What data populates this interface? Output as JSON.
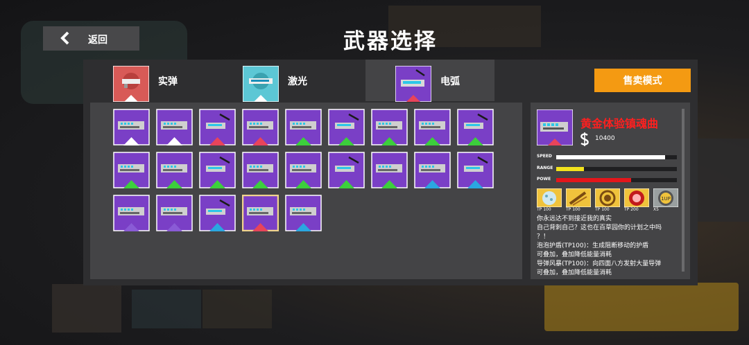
{
  "header": {
    "back_label": "返回",
    "title": "武器选择"
  },
  "tabs": [
    {
      "label": "实弹",
      "color": "#d85a57",
      "active": false
    },
    {
      "label": "激光",
      "color": "#5cc7d5",
      "active": false
    },
    {
      "label": "电弧",
      "color": "#7a3fc6",
      "active": true
    }
  ],
  "sell_mode_label": "售卖模式",
  "colors": {
    "accent": "#f49a12",
    "card_bg": "#7a3fc6",
    "selected_border": "#f0d48c"
  },
  "weapons": [
    {
      "tier": "white",
      "selected": false
    },
    {
      "tier": "white",
      "selected": false
    },
    {
      "tier": "red",
      "selected": false
    },
    {
      "tier": "red",
      "selected": false
    },
    {
      "tier": "green",
      "selected": false
    },
    {
      "tier": "green",
      "selected": false
    },
    {
      "tier": "green",
      "selected": false
    },
    {
      "tier": "green",
      "selected": false
    },
    {
      "tier": "green",
      "selected": false
    },
    {
      "tier": "green",
      "selected": false
    },
    {
      "tier": "green",
      "selected": false
    },
    {
      "tier": "green",
      "selected": false
    },
    {
      "tier": "green",
      "selected": false
    },
    {
      "tier": "green",
      "selected": false
    },
    {
      "tier": "green",
      "selected": false
    },
    {
      "tier": "green",
      "selected": false
    },
    {
      "tier": "blue",
      "selected": false
    },
    {
      "tier": "blue",
      "selected": false
    },
    {
      "tier": "purple",
      "selected": false
    },
    {
      "tier": "purple",
      "selected": false
    },
    {
      "tier": "blue",
      "selected": false
    },
    {
      "tier": "red",
      "selected": true
    },
    {
      "tier": "blue",
      "selected": false
    }
  ],
  "detail": {
    "name": "黄金体验镇魂曲",
    "price": "10400",
    "stats": [
      {
        "label": "SPEED",
        "value": 0.9,
        "color": "#ffffff"
      },
      {
        "label": "RANGE",
        "value": 0.23,
        "color": "#f2e21d"
      },
      {
        "label": "POWE",
        "value": 0.62,
        "color": "#e4161b"
      }
    ],
    "skills": [
      {
        "label": "TP 100",
        "icon": "bubble-shield-icon"
      },
      {
        "label": "TP 100",
        "icon": "missile-storm-icon"
      },
      {
        "label": "TP 100",
        "icon": "gold-wave-icon"
      },
      {
        "label": "TP 200",
        "icon": "red-burst-icon"
      },
      {
        "label": "X5",
        "icon": "one-up-icon"
      }
    ],
    "description": [
      "你永远达不到接近我的真实",
      "自己背刺自己？这也在百草园你的计划之中吗",
      "？！",
      "泡泡护盾(TP100)：生成阻断移动的护盾",
      "可叠加，叠加降低能量消耗",
      "导弹风暴(TP100)：向四面八方发射大量导弹",
      "可叠加，叠加降低能量消耗"
    ]
  }
}
